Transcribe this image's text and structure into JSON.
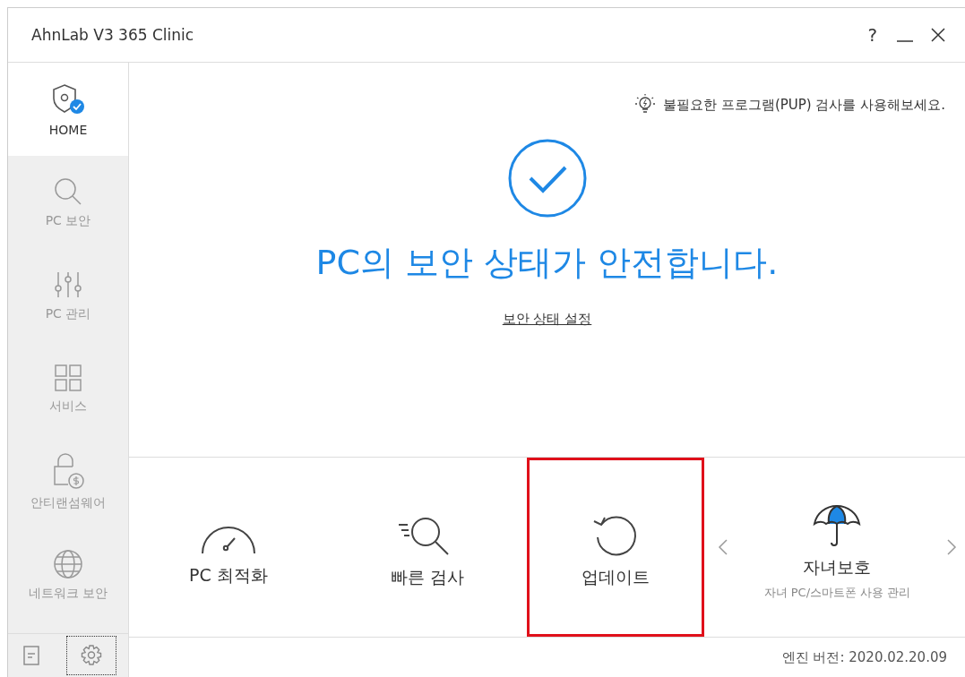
{
  "window": {
    "title": "AhnLab V3 365 Clinic",
    "controls": [
      "?"
    ]
  },
  "sidebar": {
    "items": [
      {
        "label": "HOME",
        "selected": true
      },
      {
        "label": "PC 보안",
        "selected": false
      },
      {
        "label": "PC 관리",
        "selected": false
      },
      {
        "label": "서비스",
        "selected": false
      },
      {
        "label": "안티랜섬웨어",
        "selected": false
      },
      {
        "label": "네트워크 보안",
        "selected": false
      }
    ]
  },
  "tip": "불필요한 프로그램(PUP) 검사를 사용해보세요.",
  "status": {
    "headline": "PC의 보안 상태가 안전합니다.",
    "link": "보안 상태 설정"
  },
  "tiles": [
    {
      "label": "PC 최적화",
      "highlighted": false
    },
    {
      "label": "빠른 검사",
      "highlighted": false
    },
    {
      "label": "업데이트",
      "highlighted": true
    },
    {
      "label": "자녀보호",
      "subtitle": "자녀 PC/스마트폰 사용 관리",
      "highlighted": false
    }
  ],
  "footer": {
    "engine_version": "엔진 버전: 2020.02.20.09"
  }
}
